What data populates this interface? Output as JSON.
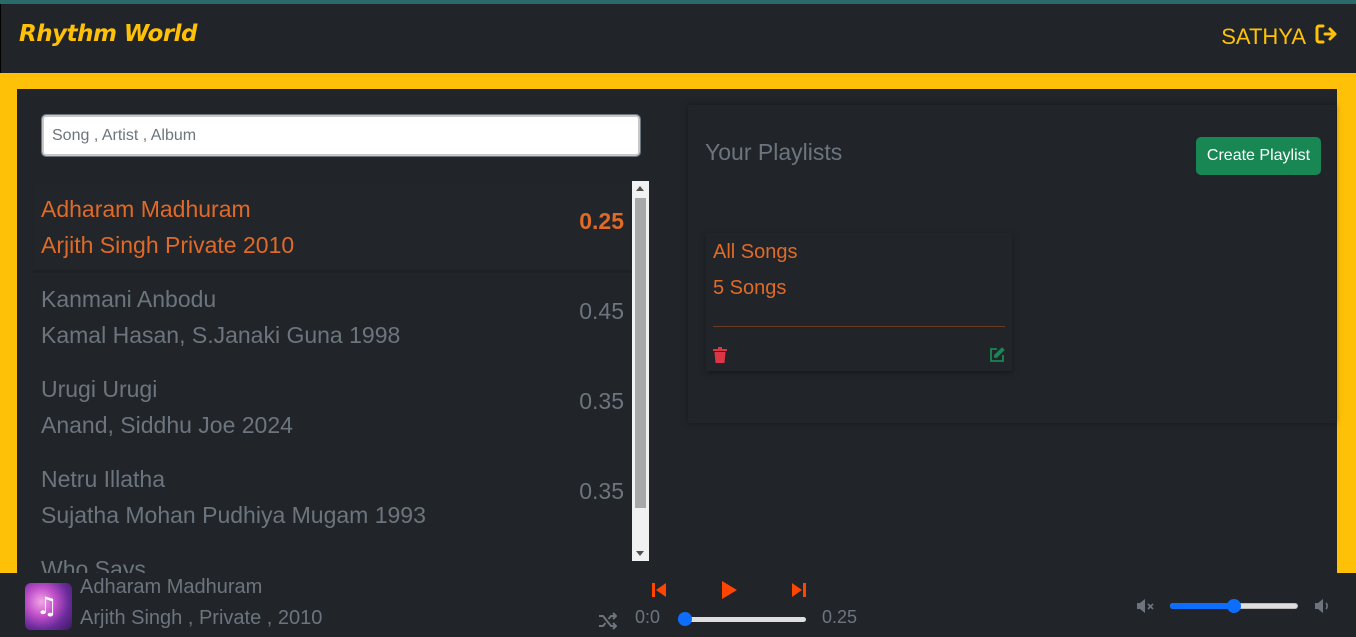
{
  "app": {
    "brand": "Rhythm World",
    "user": "SATHYA"
  },
  "search": {
    "placeholder": "Song , Artist , Album"
  },
  "songs": [
    {
      "title": "Adharam Madhuram",
      "subtitle": "Arjith Singh Private 2010",
      "duration": "0.25",
      "active": true
    },
    {
      "title": "Kanmani Anbodu",
      "subtitle": "Kamal Hasan, S.Janaki Guna 1998",
      "duration": "0.45",
      "active": false
    },
    {
      "title": "Urugi Urugi",
      "subtitle": "Anand, Siddhu Joe 2024",
      "duration": "0.35",
      "active": false
    },
    {
      "title": "Netru Illatha",
      "subtitle": "Sujatha Mohan Pudhiya Mugam 1993",
      "duration": "0.35",
      "active": false
    },
    {
      "title": "Who Says",
      "subtitle": "",
      "duration": "",
      "active": false
    }
  ],
  "playlists": {
    "heading": "Your Playlists",
    "create_label": "Create Playlist",
    "items": [
      {
        "name": "All Songs",
        "count": "5 Songs"
      }
    ]
  },
  "player": {
    "title": "Adharam Madhuram",
    "subtitle": "Arjith Singh , Private , 2010",
    "current_time": "0:0",
    "total_time": "0.25",
    "progress": 0.0,
    "volume": 0.5
  },
  "colors": {
    "accent": "#ffc107",
    "active_song": "#e06a27",
    "muted_text": "#6c757d",
    "create_button": "#198754",
    "player_controls": "#ff4500",
    "slider": "#0d6efd"
  },
  "icons": [
    "sign-out-icon",
    "trash-icon",
    "edit-icon",
    "prev-icon",
    "play-icon",
    "next-icon",
    "shuffle-icon",
    "mute-icon",
    "volume-icon"
  ]
}
